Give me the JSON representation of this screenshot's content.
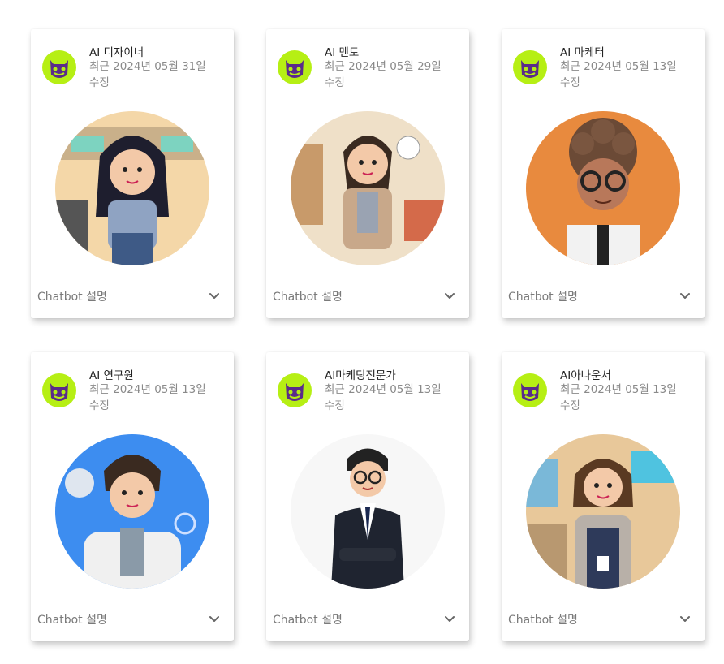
{
  "cards": [
    {
      "title": "AI 디자이너",
      "modified_prefix": "최근 2024년 05월 31일",
      "modified_suffix": "수정",
      "desc_label": "Chatbot 설명",
      "avatar_bg": "#f4d7a8"
    },
    {
      "title": "AI 멘토",
      "modified_prefix": "최근 2024년 05월 29일",
      "modified_suffix": "수정",
      "desc_label": "Chatbot 설명",
      "avatar_bg": "#efe0c8"
    },
    {
      "title": "AI 마케터",
      "modified_prefix": "최근 2024년 05월 13일",
      "modified_suffix": "수정",
      "desc_label": "Chatbot 설명",
      "avatar_bg": "#e88a3e"
    },
    {
      "title": "AI 연구원",
      "modified_prefix": "최근 2024년 05월 13일",
      "modified_suffix": "수정",
      "desc_label": "Chatbot 설명",
      "avatar_bg": "#3d8df0"
    },
    {
      "title": "AI마케팅전문가",
      "modified_prefix": "최근 2024년 05월 13일",
      "modified_suffix": "수정",
      "desc_label": "Chatbot 설명",
      "avatar_bg": "#f7f7f7"
    },
    {
      "title": "AI아나운서",
      "modified_prefix": "최근 2024년 05월 13일",
      "modified_suffix": "수정",
      "desc_label": "Chatbot 설명",
      "avatar_bg": "#e8c89a"
    }
  ],
  "colors": {
    "logo_bg": "#b6ef14",
    "logo_monster": "#5a2b8a",
    "chevron": "#666666"
  },
  "icons": {
    "logo": "purple-monster-logo-icon",
    "expand": "chevron-down-icon"
  }
}
